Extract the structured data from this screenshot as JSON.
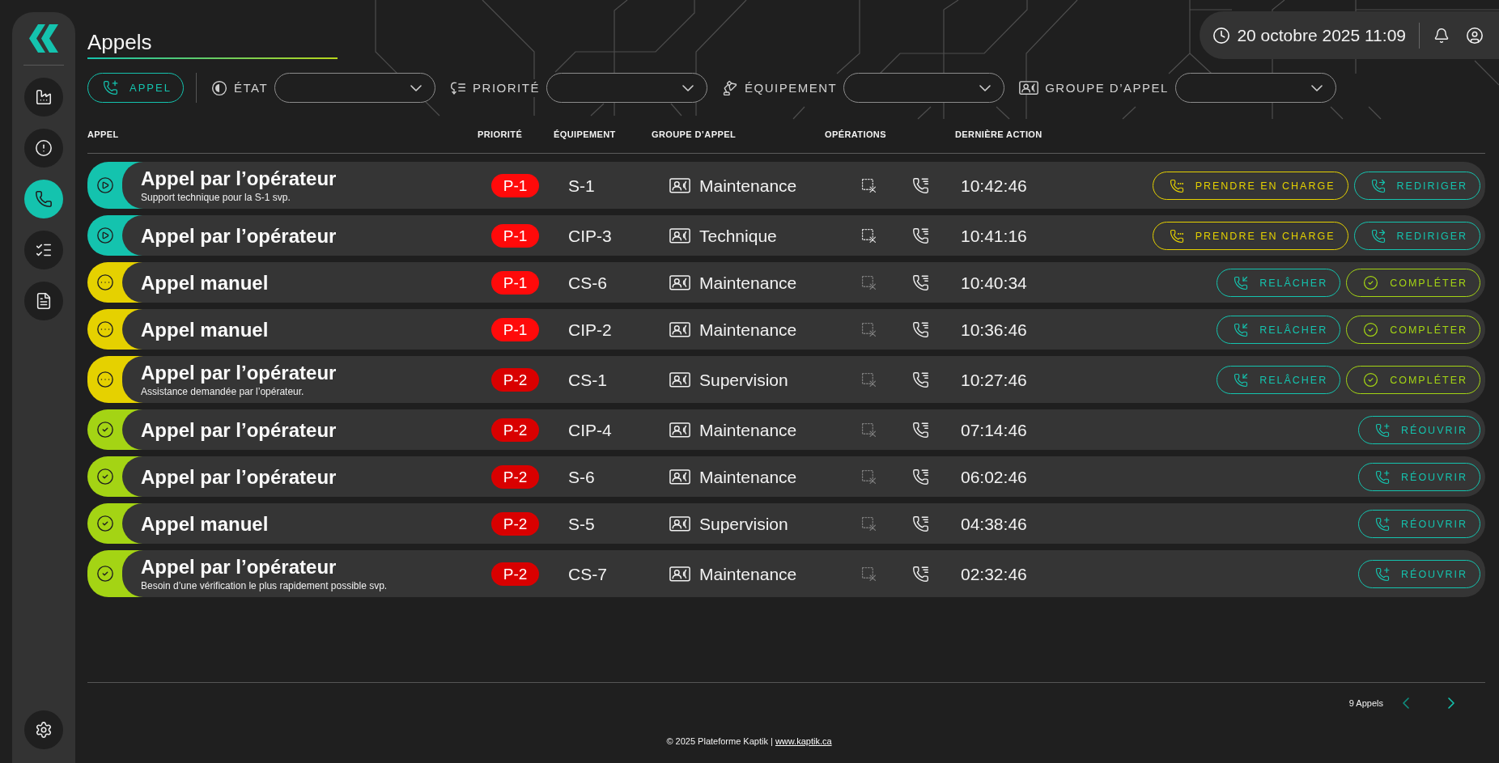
{
  "sidebar": {
    "items": [
      {
        "kind": "plant",
        "selected": false
      },
      {
        "kind": "alerts",
        "selected": false
      },
      {
        "kind": "calls",
        "selected": true
      },
      {
        "kind": "tasks",
        "selected": false
      },
      {
        "kind": "reports",
        "selected": false
      }
    ]
  },
  "header": {
    "title": "Appels",
    "datetime": "20 octobre 2025 11:09"
  },
  "filters": {
    "new_call_button": "APPEL",
    "fields": [
      {
        "kind": "state",
        "label": "ÉTAT"
      },
      {
        "kind": "priority",
        "label": "PRIORITÉ"
      },
      {
        "kind": "equipment",
        "label": "ÉQUIPEMENT"
      },
      {
        "kind": "group",
        "label": "GROUPE D’APPEL"
      }
    ]
  },
  "table": {
    "columns": [
      "APPEL",
      "PRIORITÉ",
      "ÉQUIPEMENT",
      "GROUPE D’APPEL",
      "OPÉRATIONS",
      "DERNIÈRE ACTION"
    ],
    "rows": [
      {
        "kind": "active",
        "title": "Appel par l’opérateur",
        "subtitle": "Support technique pour la S-1 svp.",
        "priority": {
          "label": "P-1",
          "color": "#ff0a0a"
        },
        "equipment": "S-1",
        "group": "Maintenance",
        "operations": [
          {
            "kind": "clear",
            "disabled": false
          },
          {
            "kind": "call_log",
            "disabled": false
          }
        ],
        "last_action": "10:42:46",
        "actions": [
          {
            "kind": "take",
            "label": "PRENDRE EN CHARGE"
          },
          {
            "kind": "redirect",
            "label": "REDIRIGER"
          }
        ]
      },
      {
        "kind": "active",
        "title": "Appel par l’opérateur",
        "priority": {
          "label": "P-1",
          "color": "#ff0a0a"
        },
        "equipment": "CIP-3",
        "group": "Technique",
        "operations": [
          {
            "kind": "clear",
            "disabled": false
          },
          {
            "kind": "call_log",
            "disabled": false
          }
        ],
        "last_action": "10:41:16",
        "actions": [
          {
            "kind": "take",
            "label": "PRENDRE EN CHARGE"
          },
          {
            "kind": "redirect",
            "label": "REDIRIGER"
          }
        ]
      },
      {
        "kind": "pending",
        "title": "Appel manuel",
        "priority": {
          "label": "P-1",
          "color": "#ff0a0a"
        },
        "equipment": "CS-6",
        "group": "Maintenance",
        "operations": [
          {
            "kind": "clear",
            "disabled": true
          },
          {
            "kind": "call_log",
            "disabled": false
          }
        ],
        "last_action": "10:40:34",
        "actions": [
          {
            "kind": "release",
            "label": "RELÂCHER"
          },
          {
            "kind": "complete",
            "label": "COMPLÉTER"
          }
        ]
      },
      {
        "kind": "pending",
        "title": "Appel manuel",
        "priority": {
          "label": "P-1",
          "color": "#ff0a0a"
        },
        "equipment": "CIP-2",
        "group": "Maintenance",
        "operations": [
          {
            "kind": "clear",
            "disabled": true
          },
          {
            "kind": "call_log",
            "disabled": false
          }
        ],
        "last_action": "10:36:46",
        "actions": [
          {
            "kind": "release",
            "label": "RELÂCHER"
          },
          {
            "kind": "complete",
            "label": "COMPLÉTER"
          }
        ]
      },
      {
        "kind": "pending",
        "title": "Appel par l’opérateur",
        "subtitle": "Assistance demandée par l’opérateur.",
        "priority": {
          "label": "P-2",
          "color": "#d90000"
        },
        "equipment": "CS-1",
        "group": "Supervision",
        "operations": [
          {
            "kind": "clear",
            "disabled": true
          },
          {
            "kind": "call_log",
            "disabled": false
          }
        ],
        "last_action": "10:27:46",
        "actions": [
          {
            "kind": "release",
            "label": "RELÂCHER"
          },
          {
            "kind": "complete",
            "label": "COMPLÉTER"
          }
        ]
      },
      {
        "kind": "completed",
        "title": "Appel par l’opérateur",
        "priority": {
          "label": "P-2",
          "color": "#d90000"
        },
        "equipment": "CIP-4",
        "group": "Maintenance",
        "operations": [
          {
            "kind": "clear",
            "disabled": true
          },
          {
            "kind": "call_log",
            "disabled": false
          }
        ],
        "last_action": "07:14:46",
        "actions": [
          {
            "kind": "reopen",
            "label": "RÉOUVRIR"
          }
        ]
      },
      {
        "kind": "completed",
        "title": "Appel par l’opérateur",
        "priority": {
          "label": "P-2",
          "color": "#d90000"
        },
        "equipment": "S-6",
        "group": "Maintenance",
        "operations": [
          {
            "kind": "clear",
            "disabled": true
          },
          {
            "kind": "call_log",
            "disabled": false
          }
        ],
        "last_action": "06:02:46",
        "actions": [
          {
            "kind": "reopen",
            "label": "RÉOUVRIR"
          }
        ]
      },
      {
        "kind": "completed",
        "title": "Appel manuel",
        "priority": {
          "label": "P-2",
          "color": "#d90000"
        },
        "equipment": "S-5",
        "group": "Supervision",
        "operations": [
          {
            "kind": "clear",
            "disabled": true
          },
          {
            "kind": "call_log",
            "disabled": false
          }
        ],
        "last_action": "04:38:46",
        "actions": [
          {
            "kind": "reopen",
            "label": "RÉOUVRIR"
          }
        ]
      },
      {
        "kind": "completed",
        "title": "Appel par l’opérateur",
        "subtitle": "Besoin d’une vérification le plus rapidement possible svp.",
        "priority": {
          "label": "P-2",
          "color": "#d90000"
        },
        "equipment": "CS-7",
        "group": "Maintenance",
        "operations": [
          {
            "kind": "clear",
            "disabled": true
          },
          {
            "kind": "call_log",
            "disabled": false
          }
        ],
        "last_action": "02:32:46",
        "actions": [
          {
            "kind": "reopen",
            "label": "RÉOUVRIR"
          }
        ]
      }
    ]
  },
  "pagination": {
    "count": "9 Appels"
  },
  "footer": {
    "text": "© 2025 Plateforme Kaptik |",
    "link": "www.kaptik.ca"
  }
}
